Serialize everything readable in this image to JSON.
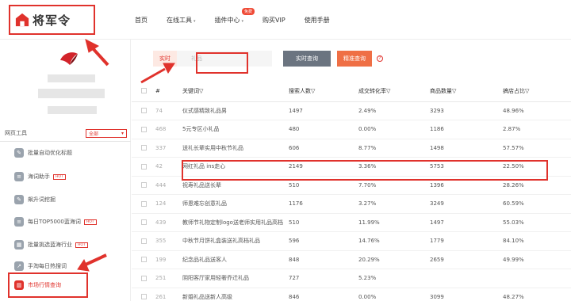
{
  "logo": {
    "text": "将军令"
  },
  "nav": {
    "items": [
      {
        "label": "首页"
      },
      {
        "label": "在线工具",
        "caret": "▾"
      },
      {
        "label": "插件中心",
        "caret": "▾",
        "badge": "免费"
      },
      {
        "label": "购买VIP"
      },
      {
        "label": "使用手册"
      }
    ]
  },
  "sidebar": {
    "tool_label": "网页工具",
    "select_value": "全部",
    "items": [
      {
        "label": "批量自动优化标题",
        "hot": ""
      },
      {
        "label": "海词助手",
        "hot": "HOT"
      },
      {
        "label": "飙升词挖掘",
        "hot": ""
      },
      {
        "label": "每日TOP5000蓝海词",
        "hot": "HOT"
      },
      {
        "label": "批量挑选蓝海行业",
        "hot": "HOT"
      },
      {
        "label": "手淘每日热搜词",
        "hot": ""
      },
      {
        "label": "市场行情查询",
        "hot": ""
      }
    ]
  },
  "search": {
    "realtime_tag": "实时",
    "placeholder": "礼品",
    "btn_realtime": "实时查询",
    "btn_precise": "精准查询",
    "help": "?"
  },
  "table": {
    "headers": [
      "#",
      "关键词▽",
      "搜索人数▽",
      "成交转化率▽",
      "商品数量▽",
      "搞店占比▽"
    ],
    "rows": [
      {
        "no": "74",
        "kw": "仪式感精致礼品男",
        "search": "1497",
        "conv": "2.49%",
        "goods": "3293",
        "share": "48.96%"
      },
      {
        "no": "468",
        "kw": "5元专区小礼品",
        "search": "480",
        "conv": "0.00%",
        "goods": "1186",
        "share": "2.87%"
      },
      {
        "no": "337",
        "kw": "送礼长辈实用中秋节礼品",
        "search": "606",
        "conv": "8.77%",
        "goods": "1498",
        "share": "57.57%"
      },
      {
        "no": "42",
        "kw": "网红礼品 ins走心",
        "search": "2149",
        "conv": "3.36%",
        "goods": "5753",
        "share": "22.50%"
      },
      {
        "no": "444",
        "kw": "祝寿礼品送长辈",
        "search": "510",
        "conv": "7.70%",
        "goods": "1396",
        "share": "28.26%"
      },
      {
        "no": "124",
        "kw": "师恩难忘创意礼品",
        "search": "1176",
        "conv": "3.27%",
        "goods": "3249",
        "share": "60.59%"
      },
      {
        "no": "439",
        "kw": "教师节礼物定制logo送老师实用礼品高档",
        "search": "510",
        "conv": "11.99%",
        "goods": "1497",
        "share": "55.03%"
      },
      {
        "no": "355",
        "kw": "中秋节月饼礼盒装送礼高档礼品",
        "search": "596",
        "conv": "14.76%",
        "goods": "1779",
        "share": "84.10%"
      },
      {
        "no": "199",
        "kw": "纪念品礼品送客人",
        "search": "848",
        "conv": "20.29%",
        "goods": "2659",
        "share": "49.99%"
      },
      {
        "no": "251",
        "kw": "阴阳客厅家用轻奢乔迁礼品",
        "search": "727",
        "conv": "5.23%",
        "goods": "",
        "share": ""
      },
      {
        "no": "261",
        "kw": "新婚礼品送新人高级",
        "search": "846",
        "conv": "0.00%",
        "goods": "3099",
        "share": "48.27%"
      }
    ]
  },
  "colors": {
    "accent": "#e0322c",
    "orange": "#ef6f45",
    "grey_button": "#6b7480"
  }
}
